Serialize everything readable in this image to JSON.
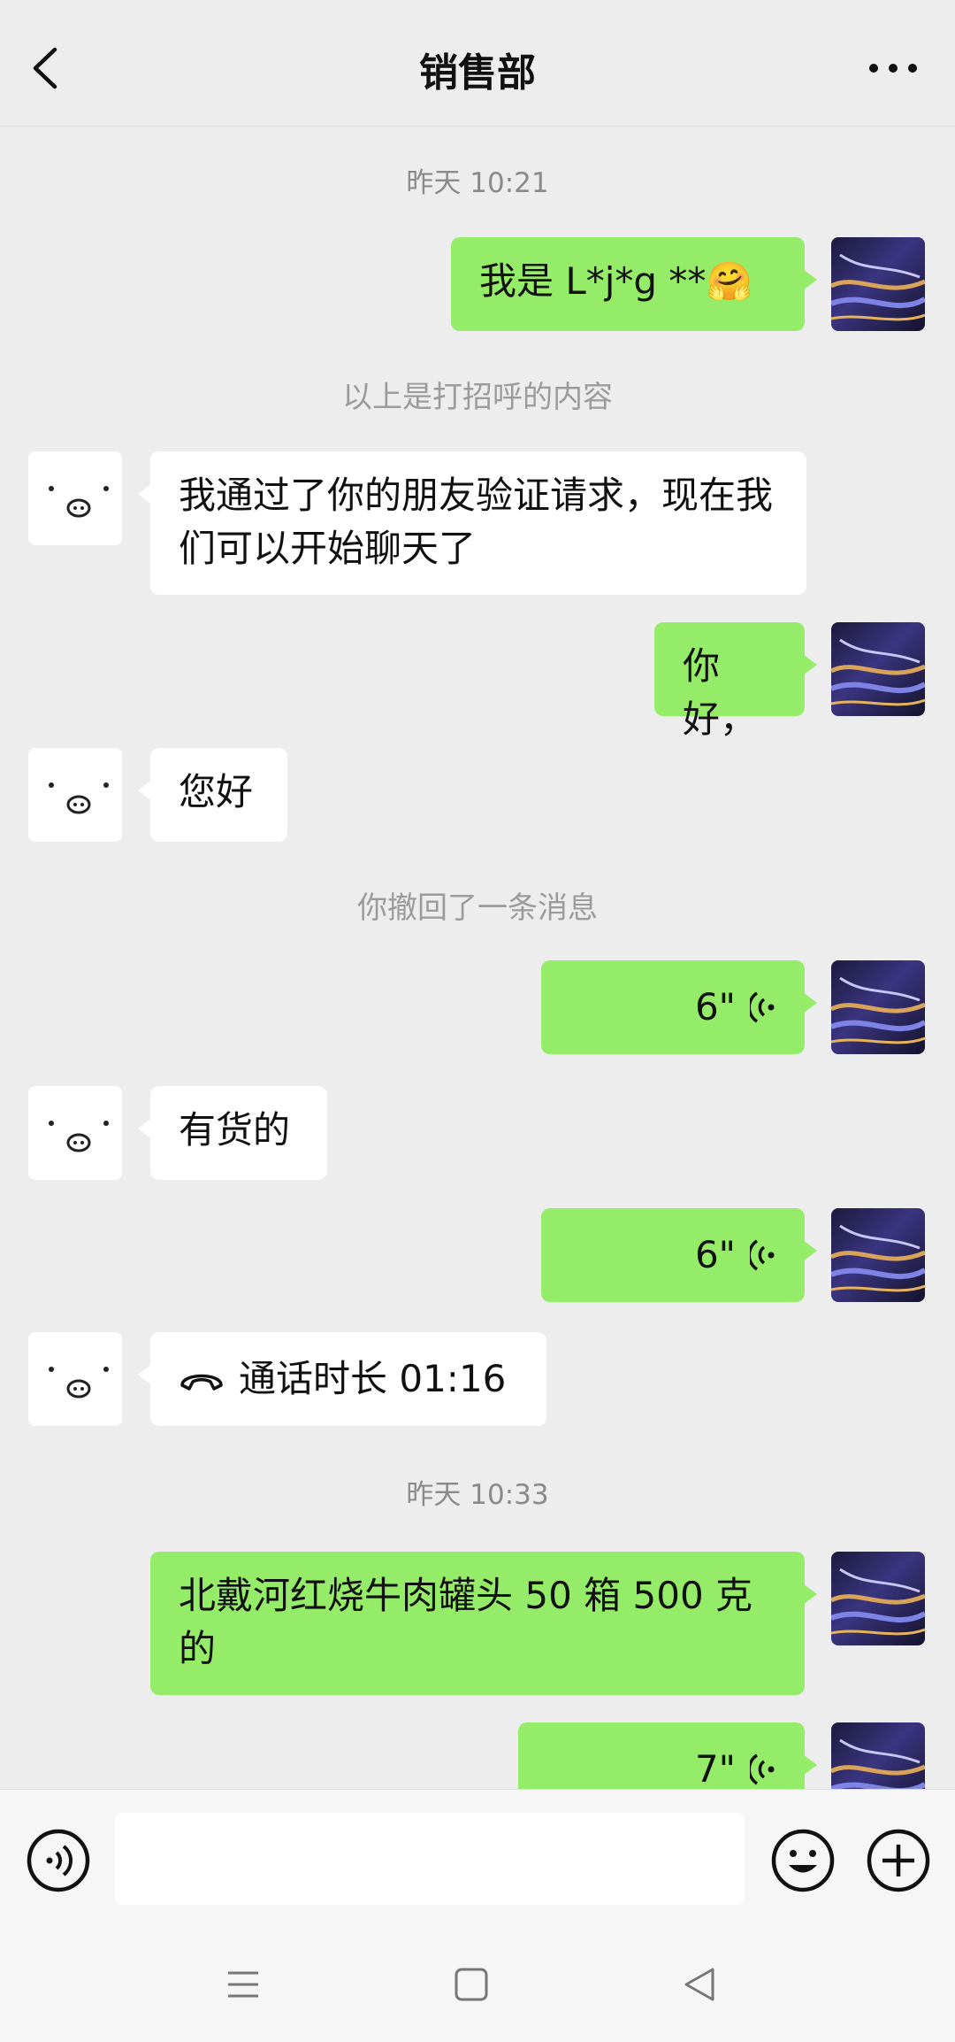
{
  "header": {
    "title": "销售部"
  },
  "messages": {
    "time1": "昨天 10:21",
    "m1": "我是 L*j*g  **",
    "m1_emoji": "🤗",
    "sys1": "以上是打招呼的内容",
    "m2": "我通过了你的朋友验证请求，现在我们可以开始聊天了",
    "m3": "你好，",
    "m4": "您好",
    "sys2": "你撤回了一条消息",
    "v1": "6\"",
    "m5": "有货的",
    "v2": "6\"",
    "call": "通话时长 01:16",
    "time2": "昨天 10:33",
    "m6": "北戴河红烧牛肉罐头 50 箱 500 克的",
    "v3": "7\""
  },
  "icons": {
    "back": "chevron-left-icon",
    "more": "more-icon",
    "voice_wave": "voice-wave-icon",
    "phone": "phone-icon",
    "voice_input": "voice-input-icon",
    "emoji": "emoji-icon",
    "plus": "plus-icon"
  },
  "colors": {
    "my_bubble": "#95ec69",
    "their_bubble": "#ffffff",
    "background": "#ededed"
  }
}
